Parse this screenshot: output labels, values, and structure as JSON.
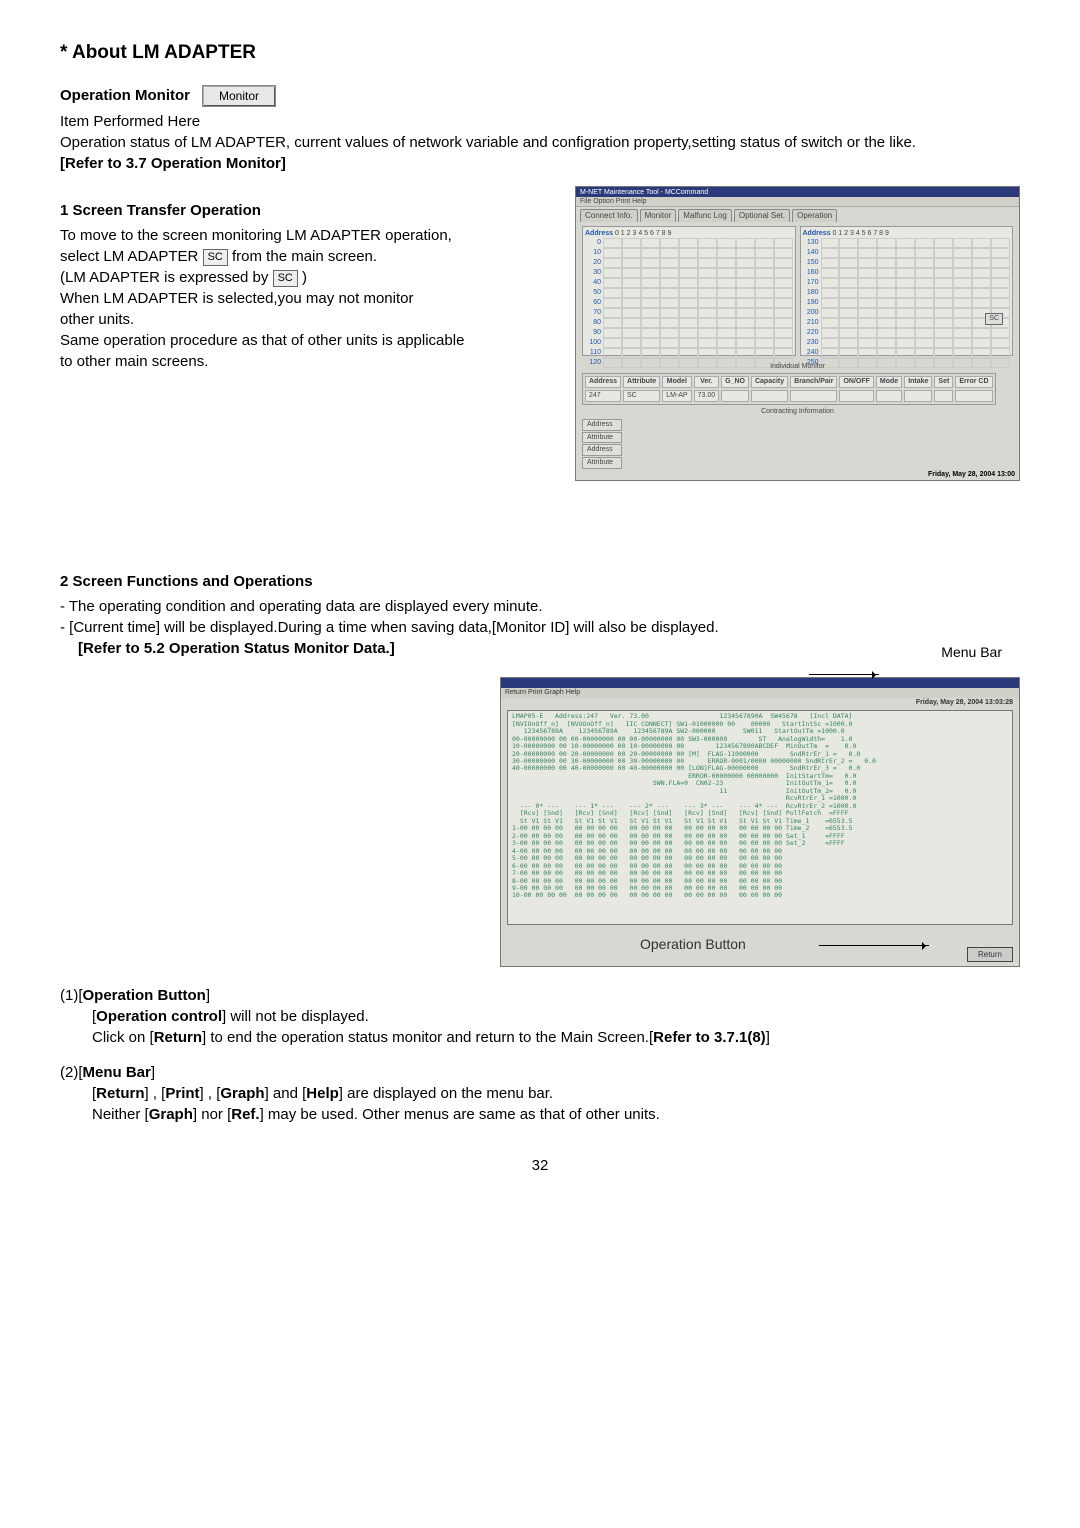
{
  "title_prefix": "* ",
  "title": "About LM ADAPTER",
  "op_monitor_label": "Operation Monitor",
  "monitor_btn": "Monitor",
  "item_performed": "Item Performed Here",
  "op_status_desc": "Operation status of LM ADAPTER, current values of network variable and configration property,setting status of switch or the like.",
  "refer37": "[Refer to 3.7 Operation Monitor]",
  "step1_title": "1 Screen Transfer Operation",
  "step1_l1a": "To move to the screen monitoring LM ADAPTER operation,",
  "step1_l1b": "select LM ADAPTER",
  "step1_l1c": "   from the main screen.",
  "sc_badge": "SC",
  "step1_l2a": "(LM ADAPTER is expressed by",
  "step1_l2b": " )",
  "step1_l3": "When LM ADAPTER is selected,you may not monitor",
  "step1_l4": "other units.",
  "step1_l5": "Same operation procedure as that of other units is applicable",
  "step1_l6": "to other main screens.",
  "shot1": {
    "titlebar": "M-NET Maintenance Tool - MCCommand",
    "menubar": "File  Option  Print  Help",
    "tabs": [
      "Connect Info.",
      "Monitor",
      "Malfunc Log",
      "Optional Set.",
      "Operation"
    ],
    "addr_label": "Address",
    "addr_cols": "0  1  2  3  4  5  6  7  8  9",
    "left_nums": [
      "0",
      "10",
      "20",
      "30",
      "40",
      "50",
      "60",
      "70",
      "80",
      "90",
      "100",
      "110",
      "120"
    ],
    "right_nums": [
      "130",
      "140",
      "150",
      "160",
      "170",
      "180",
      "190",
      "200",
      "210",
      "220",
      "230",
      "240",
      "250"
    ],
    "indiv": "Individual Monitor",
    "table_hdr": [
      "Address",
      "Attribute",
      "Model",
      "Ver.",
      "G_NO",
      "Capacity",
      "Branch/Pair",
      "ON/OFF",
      "Mode",
      "Intake",
      "Set",
      "Error CD"
    ],
    "table_row": [
      "247",
      "SC",
      "LM-AP",
      "73.00",
      "",
      "",
      "",
      "",
      "",
      "",
      "",
      ""
    ],
    "contracting": "Contracting Information",
    "bottom_items": [
      "Address",
      "Attribute",
      "Address",
      "Attribute"
    ],
    "footer": "Friday, May 28, 2004 13:00",
    "sc_badge": "SC"
  },
  "step2_title": "2 Screen Functions and Operations",
  "step2_l1": "- The operating condition and operating data are displayed every minute.",
  "step2_l2": "- [Current time] will be displayed.During a time when saving data,[Monitor ID] will also be displayed.",
  "step2_l3": "[Refer to 5.2 Operation Status Monitor Data.]",
  "menu_bar_label": "Menu Bar",
  "op_button_label": "Operation  Button",
  "shot2": {
    "menubar": "Return  Print  Graph  Help",
    "date": "Friday, May 28, 2004 13:03:28",
    "return_btn": "Return",
    "body": "LMAP05-E   Address:247   Ver. 73.00                  1234567890A  SW45678   [Incl DATA]\n[NVIOnOff_n]  [NVOOnOff_n]   IIC CONNECT] SW1-01000000 00    00000   StartIntSc =1000.0\n   123456789A    123456789A    123456789A SW2-000000       SW011   StartOutTm =1000.0\n00-00000000 00 00-00000000 00 00-00000000 00 SW3-000000        ST   AnalogWidth=    1.0\n10-00000000 00 10-00000000 00 10-00000000 00        1234567890ABCDEF  MinOutTm  =    0.0\n20-00000000 00 20-00000000 00 20-00000000 00 [M]  FLAG-11000000        SndRtrEr_1 =   0.0\n30-00000000 00 30-00000000 00 30-00000000 00      ERROR-0001/0000 00000000 SndRtrEr_2 =   0.0\n40-00000000 00 40-00000000 00 40-00000000 00 [LON]FLAG-00000000        SndRtrEr_3 =   0.0\n                                             ERROR-00000000 00000000  InitStartTm=   0.0\n                                    SWN.FLA=0  CN02-23                InitOutTm_1=   0.0\n                                                     11               InitOutTm_2=   0.0\n                                                                      RcvRtrEr_1 =1000.0\n  --- 0* ---    --- 1* ---    --- 2* ---    --- 3* ---    --- 4* ---  RcvRtrEr_2 =1000.0\n  [Rcv] [Snd]   [Rcv] [Snd]   [Rcv] [Snd]   [Rcv] [Snd]   [Rcv] [Snd] PollFetch  =FFFF\n  St V1 St V1   St V1 St V1   St V1 St V1   St V1 St V1   St V1 St V1 Time_1    =6553.5\n1-00 00 00 00   00 00 00 00   00 00 00 00   00 00 00 00   00 00 00 00 Time_2    =6553.5\n2-00 00 00 00   00 00 00 00   00 00 00 00   00 00 00 00   00 00 00 00 Set_1     =FFFF\n3-00 00 00 00   00 00 00 00   00 00 00 00   00 00 00 00   00 00 00 00 Set_2     =FFFF\n4-00 00 00 00   00 00 00 00   00 00 00 00   00 00 00 00   00 00 00 00\n5-00 00 00 00   00 00 00 00   00 00 00 00   00 00 00 00   00 00 00 00\n6-00 00 00 00   00 00 00 00   00 00 00 00   00 00 00 00   00 00 00 00\n7-00 00 00 00   00 00 00 00   00 00 00 00   00 00 00 00   00 00 00 00\n8-00 00 00 00   00 00 00 00   00 00 00 00   00 00 00 00   00 00 00 00\n9-00 00 00 00   00 00 00 00   00 00 00 00   00 00 00 00   00 00 00 00\n10-00 00 00 00  00 00 00 00   00 00 00 00   00 00 00 00   00 00 00 00"
  },
  "item1_title": "(1)[Operation Button]",
  "item1_l1": "[Operation control] will not be displayed.",
  "item1_l2a": "Click on [",
  "item1_l2b": "Return",
  "item1_l2c": "] to end the operation status monitor and return to the Main Screen.[",
  "item1_l2d": "Refer to 3.7.1(8)",
  "item1_l2e": "]",
  "item2_title": "(2)[Menu Bar]",
  "item2_l1a": "[",
  "item2_l1b": "Return",
  "item2_l1c": "] , [",
  "item2_l1d": "Print",
  "item2_l1e": "] , [",
  "item2_l1f": "Graph",
  "item2_l1g": "] and [",
  "item2_l1h": "Help",
  "item2_l1i": "] are displayed on the menu bar.",
  "item2_l2a": "Neither [",
  "item2_l2b": "Graph",
  "item2_l2c": "] nor [",
  "item2_l2d": "Ref.",
  "item2_l2e": "] may be used. Other menus are same as that of other units.",
  "page_num": "32"
}
